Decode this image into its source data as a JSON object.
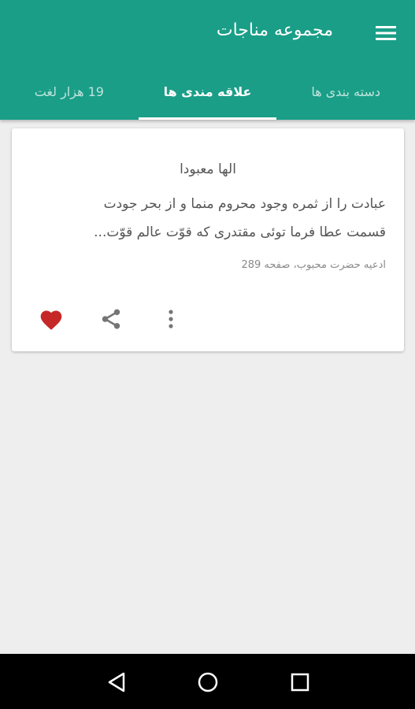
{
  "app_bar": {
    "title": "مجموعه مناجات",
    "menu_icon": "hamburger-menu-icon",
    "color": "#1a9e87"
  },
  "tabs": [
    {
      "label": "دسته بندی ها",
      "active": false
    },
    {
      "label": "علاقه مندی ها",
      "active": true
    },
    {
      "label": "19 هزار لغت",
      "active": false
    }
  ],
  "card": {
    "title": "الها معبودا",
    "lines": [
      "عبادت را از ثمره وجود محروم منما و از بحر جودت",
      "قسمت عطا فرما توئی مقتدری که قوّت عالم قوّت..."
    ],
    "source": "ادعیه حضرت محبوب، صفحه 289",
    "actions": {
      "more_icon": "more-vertical-icon",
      "share_icon": "share-icon",
      "favorite_icon": "heart-icon",
      "favorite_color": "#c62828",
      "favorited": true
    }
  },
  "nav_bar": {
    "back_icon": "back-triangle-icon",
    "home_icon": "home-circle-icon",
    "recents_icon": "recents-square-icon"
  }
}
